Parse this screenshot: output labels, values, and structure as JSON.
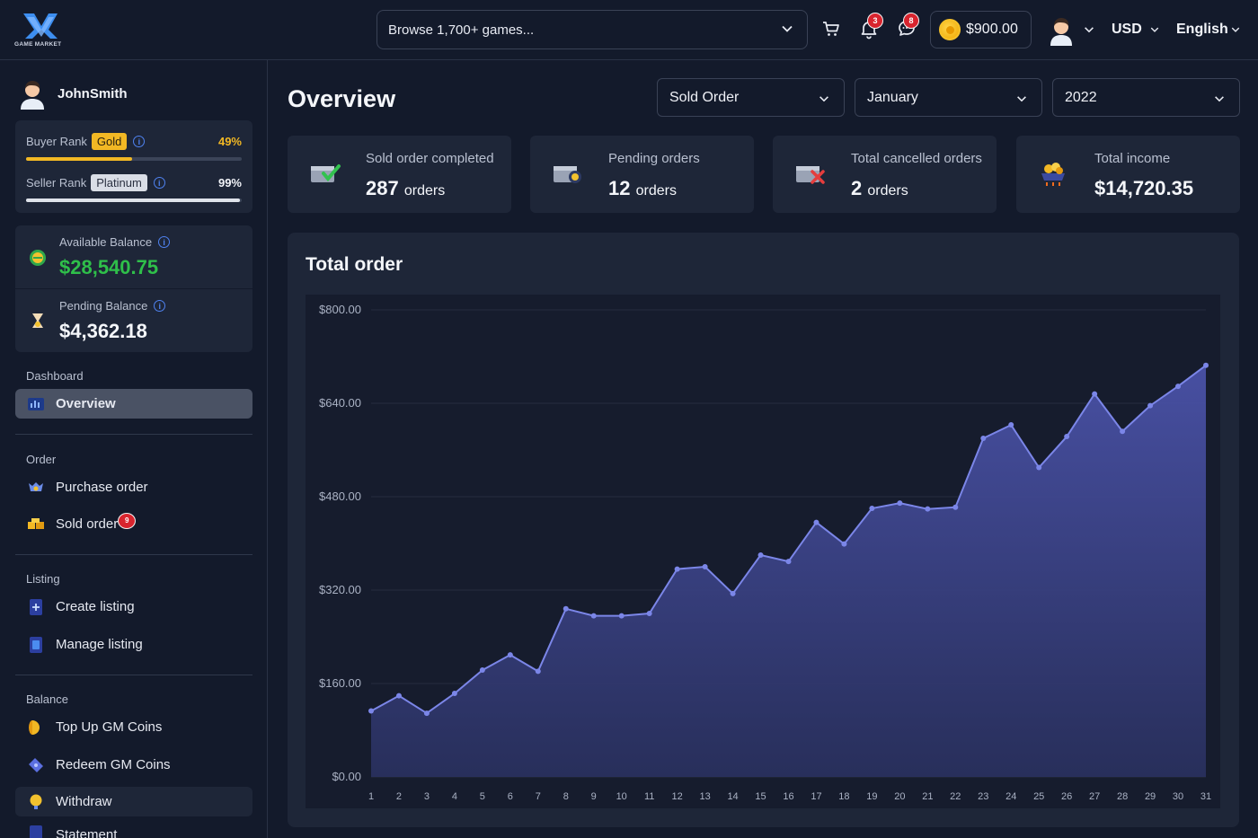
{
  "brand": {
    "logo_text": "GAME MARKET"
  },
  "search": {
    "placeholder": "Browse 1,700+ games..."
  },
  "header": {
    "notifications_count": "3",
    "messages_count": "8",
    "wallet_amount": "$900.00",
    "currency": "USD",
    "language": "English",
    "icons": [
      "cart-icon",
      "bell-icon",
      "chat-icon",
      "coin-icon",
      "avatar",
      "chevron-down-icon"
    ]
  },
  "sidebar": {
    "username": "JohnSmith",
    "buyer_rank": {
      "label": "Buyer Rank",
      "tag": "Gold",
      "percent_text": "49%",
      "percent": 49,
      "color": "#f2b824"
    },
    "seller_rank": {
      "label": "Seller Rank",
      "tag": "Platinum",
      "percent_text": "99%",
      "percent": 99,
      "color": "#dfe3ea"
    },
    "available_balance": {
      "label": "Available Balance",
      "value": "$28,540.75",
      "color": "#2fbf4a"
    },
    "pending_balance": {
      "label": "Pending Balance",
      "value": "$4,362.18"
    },
    "sections": {
      "dashboard": "Dashboard",
      "order": "Order",
      "listing": "Listing",
      "balance": "Balance"
    },
    "items": {
      "overview": "Overview",
      "purchase_order": "Purchase order",
      "sold_order": "Sold order",
      "sold_order_badge": "9",
      "create_listing": "Create listing",
      "manage_listing": "Manage listing",
      "top_up": "Top Up GM Coins",
      "redeem": "Redeem GM Coins",
      "withdraw": "Withdraw",
      "statement": "Statement"
    }
  },
  "main": {
    "title": "Overview",
    "filters": {
      "type": "Sold Order",
      "month": "January",
      "year": "2022"
    },
    "stats": [
      {
        "label": "Sold order completed",
        "value": "287",
        "unit": "orders"
      },
      {
        "label": "Pending orders",
        "value": "12",
        "unit": "orders"
      },
      {
        "label": "Total cancelled orders",
        "value": "2",
        "unit": "orders"
      },
      {
        "label": "Total income",
        "value": "$14,720.35",
        "unit": ""
      }
    ],
    "chart_title": "Total order"
  },
  "chart_data": {
    "type": "area",
    "title": "Total order",
    "xlabel": "",
    "ylabel": "",
    "x": [
      1,
      2,
      3,
      4,
      5,
      6,
      7,
      8,
      9,
      10,
      11,
      12,
      13,
      14,
      15,
      16,
      17,
      18,
      19,
      20,
      21,
      22,
      23,
      24,
      25,
      26,
      27,
      28,
      29,
      30,
      31
    ],
    "ylim": [
      0,
      800
    ],
    "yticks": [
      "$0.00",
      "$160.00",
      "$320.00",
      "$480.00",
      "$640.00",
      "$800.00"
    ],
    "series": [
      {
        "name": "",
        "values": [
          113,
          139,
          109,
          143,
          183,
          209,
          181,
          288,
          276,
          276,
          280,
          356,
          360,
          314,
          380,
          369,
          436,
          399,
          460,
          469,
          459,
          462,
          580,
          603,
          530,
          583,
          656,
          592,
          636,
          669,
          705
        ]
      }
    ],
    "grid": true,
    "color": "#7b86e8"
  }
}
